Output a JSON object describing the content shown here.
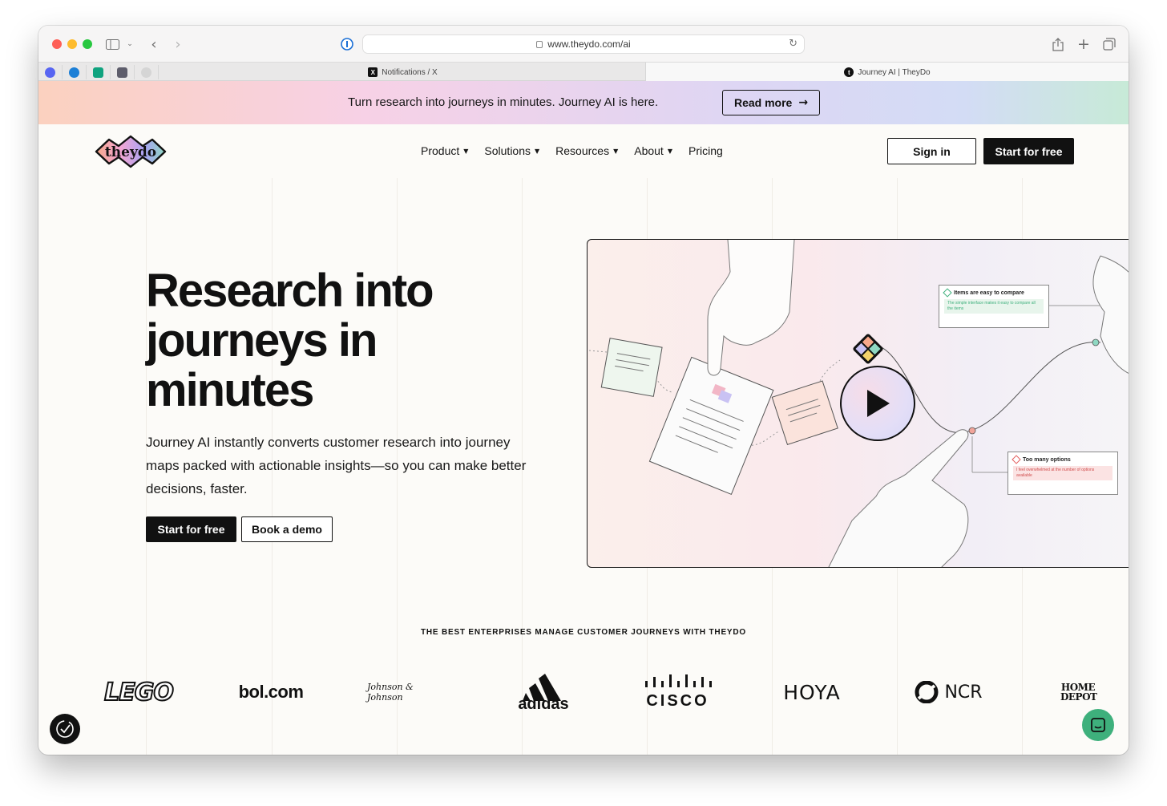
{
  "browser": {
    "url": "www.theydo.com/ai",
    "tabs": [
      {
        "label": "Notifications / X",
        "active": false
      },
      {
        "label": "Journey AI | TheyDo",
        "active": true
      }
    ],
    "pinned_tabs": [
      "discord-icon",
      "app-icon",
      "chatgpt-icon",
      "photo-icon",
      "github-icon"
    ]
  },
  "banner": {
    "text": "Turn research into journeys in minutes. Journey AI is here.",
    "button_label": "Read more"
  },
  "nav": {
    "logo_text": "theydo",
    "items": [
      {
        "label": "Product",
        "has_dropdown": true
      },
      {
        "label": "Solutions",
        "has_dropdown": true
      },
      {
        "label": "Resources",
        "has_dropdown": true
      },
      {
        "label": "About",
        "has_dropdown": true
      },
      {
        "label": "Pricing",
        "has_dropdown": false
      }
    ],
    "sign_in": "Sign in",
    "start_free": "Start for free"
  },
  "hero": {
    "title": "Research into journeys in minutes",
    "subtitle": "Journey AI instantly converts customer research into journey maps packed with actionable insights—so you can make better decisions, faster.",
    "cta_primary": "Start for free",
    "cta_secondary": "Book a demo"
  },
  "video": {
    "card_positive": {
      "title": "Items are easy to compare",
      "body": "The simple interface makes it easy to compare all the items"
    },
    "card_negative": {
      "title": "Too many options",
      "body": "I feel overwhelmed at the number of options available"
    }
  },
  "logos": {
    "title": "THE BEST ENTERPRISES MANAGE CUSTOMER JOURNEYS WITH THEYDO",
    "brands": [
      "LEGO",
      "bol.com",
      "Johnson & Johnson",
      "adidas",
      "CISCO",
      "HOYA",
      "NCR",
      "HOME DEPOT"
    ]
  },
  "colors": {
    "accent": "#111111",
    "chat_button": "#3eb07c"
  }
}
